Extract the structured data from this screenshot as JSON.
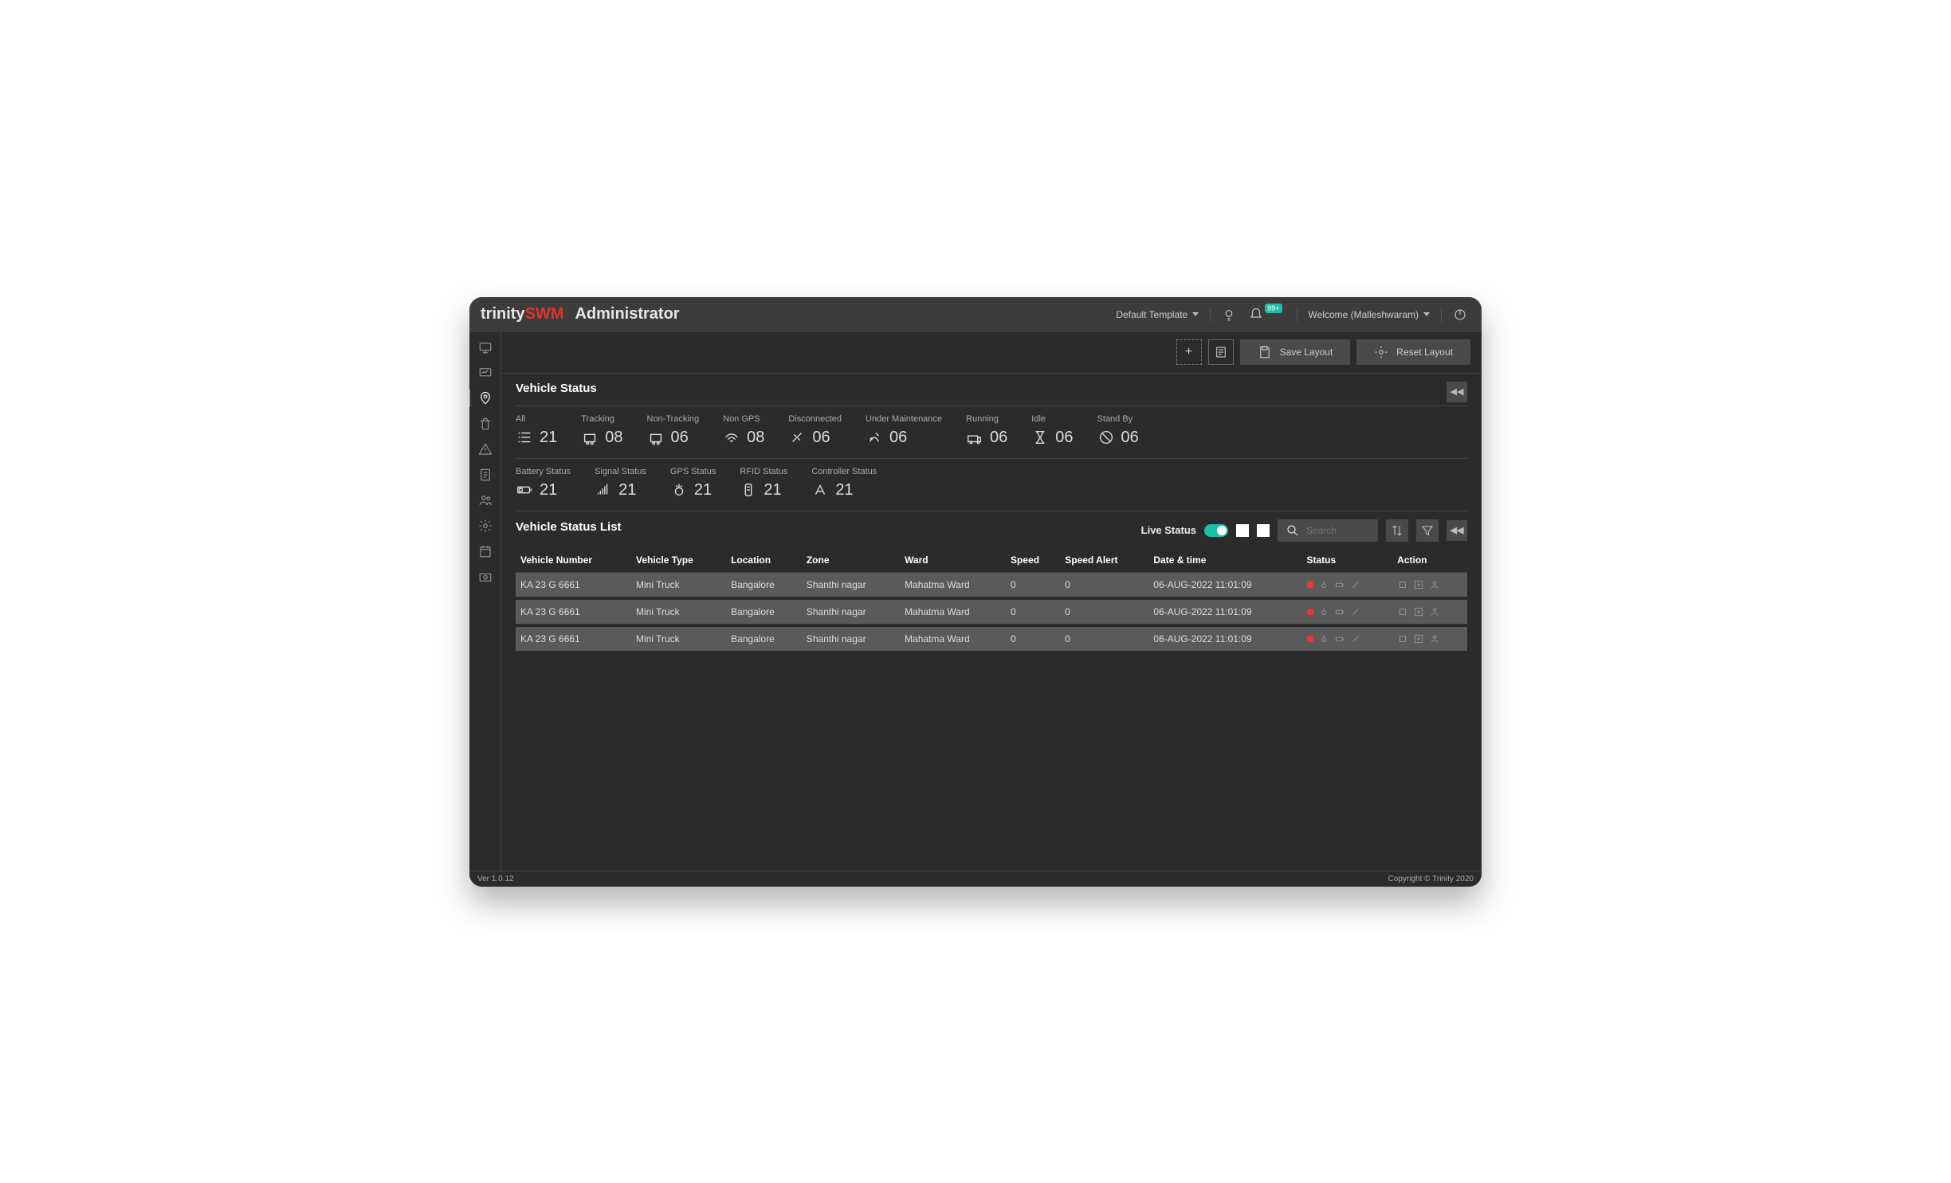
{
  "header": {
    "logo_a": "trinity",
    "logo_b": "SWM",
    "role": "Administrator",
    "template": "Default Template",
    "welcome": "Welcome (Malleshwaram)",
    "badge": "99+"
  },
  "toolbar": {
    "save": "Save Layout",
    "reset": "Reset Layout"
  },
  "section1": {
    "title": "Vehicle Status",
    "row1": [
      {
        "label": "All",
        "val": "21"
      },
      {
        "label": "Tracking",
        "val": "08"
      },
      {
        "label": "Non-Tracking",
        "val": "06"
      },
      {
        "label": "Non GPS",
        "val": "08"
      },
      {
        "label": "Disconnected",
        "val": "06"
      },
      {
        "label": "Under Maintenance",
        "val": "06"
      },
      {
        "label": "Running",
        "val": "06"
      },
      {
        "label": "Idle",
        "val": "06"
      },
      {
        "label": "Stand By",
        "val": "06"
      }
    ],
    "row2": [
      {
        "label": "Battery Status",
        "val": "21"
      },
      {
        "label": "Signal Status",
        "val": "21"
      },
      {
        "label": "GPS Status",
        "val": "21"
      },
      {
        "label": "RFID Status",
        "val": "21"
      },
      {
        "label": "Controller Status",
        "val": "21"
      }
    ]
  },
  "list": {
    "title": "Vehicle Status List",
    "live": "Live Status",
    "search_ph": "Search",
    "cols": [
      "Vehicle Number",
      "Vehicle Type",
      "Location",
      "Zone",
      "Ward",
      "Speed",
      "Speed Alert",
      "Date & time",
      "Status",
      "Action"
    ],
    "rows": [
      {
        "num": "KA 23 G 6661",
        "type": "Mini Truck",
        "loc": "Bangalore",
        "zone": "Shanthi nagar",
        "ward": "Mahatma Ward",
        "speed": "0",
        "alert": "0",
        "dt": "06-AUG-2022 11:01:09"
      },
      {
        "num": "KA 23 G 6661",
        "type": "Mini Truck",
        "loc": "Bangalore",
        "zone": "Shanthi nagar",
        "ward": "Mahatma Ward",
        "speed": "0",
        "alert": "0",
        "dt": "06-AUG-2022 11:01:09"
      },
      {
        "num": "KA 23 G 6661",
        "type": "Mini Truck",
        "loc": "Bangalore",
        "zone": "Shanthi nagar",
        "ward": "Mahatma Ward",
        "speed": "0",
        "alert": "0",
        "dt": "06-AUG-2022 11:01:09"
      }
    ]
  },
  "footer": {
    "ver": "Ver 1.0.12",
    "copy": "Copyright © Trinity 2020"
  }
}
